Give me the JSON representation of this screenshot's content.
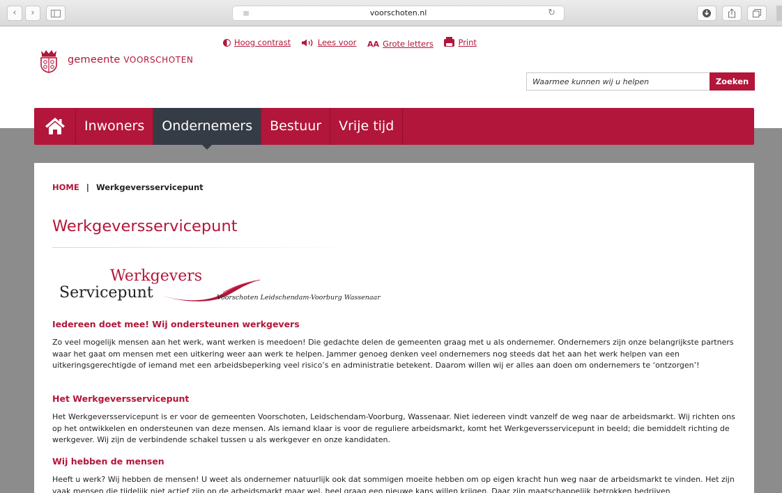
{
  "browser": {
    "url": "voorschoten.nl"
  },
  "header": {
    "logo_text_pre": "gemeente",
    "logo_text_name": "VOORSCHOTEN",
    "tools": [
      {
        "icon": "contrast-icon",
        "label": "Hoog contrast"
      },
      {
        "icon": "speaker-icon",
        "label": "Lees voor"
      },
      {
        "icon": "font-size-icon",
        "label": "Grote letters",
        "glyph": "AA"
      },
      {
        "icon": "print-icon",
        "label": "Print"
      }
    ],
    "search": {
      "placeholder": "Waarmee kunnen wij u helpen",
      "button_label": "Zoeken"
    }
  },
  "nav": {
    "items": [
      {
        "label": "Inwoners",
        "active": false
      },
      {
        "label": "Ondernemers",
        "active": true
      },
      {
        "label": "Bestuur",
        "active": false
      },
      {
        "label": "Vrije tijd",
        "active": false
      }
    ]
  },
  "content": {
    "breadcrumb": {
      "home": "HOME",
      "separator": "|",
      "current": "Werkgeversservicepunt"
    },
    "title": "Werkgeversservicepunt",
    "partner_logo": {
      "line1": "Werkgevers",
      "line2": "Servicepunt",
      "subtitle": "Voorschoten Leidschendam-Voorburg Wassenaar"
    },
    "sections": [
      {
        "heading": "Iedereen doet mee! Wij ondersteunen werkgevers",
        "body": "Zo veel mogelijk mensen aan het werk, want werken is meedoen! Die gedachte delen de gemeenten graag met u als ondernemer. Ondernemers zijn onze belangrijkste partners waar het gaat om mensen met een uitkering weer aan werk te helpen. Jammer genoeg denken veel ondernemers nog steeds dat het aan het werk helpen van een uitkeringsgerechtigde of iemand met een arbeidsbeperking veel risico’s en administratie betekent. Daarom willen wij er alles aan doen om  ondernemers te ‘ontzorgen’!"
      },
      {
        "heading": "Het Werkgeversservicepunt",
        "body": "Het Werkgeversservicepunt is er voor de gemeenten Voorschoten, Leidschendam-Voorburg, Wassenaar. Niet iedereen vindt vanzelf de weg naar de arbeidsmarkt. Wij richten ons op  het ontwikkelen en ondersteunen van deze mensen. Als iemand klaar is voor de reguliere arbeidsmarkt, komt het Werkgeversservicepunt in beeld; die bemiddelt richting de werkgever. Wij zijn de verbindende schakel tussen u als werkgever en onze kandidaten."
      },
      {
        "heading": "Wij hebben de mensen",
        "body": "Heeft u werk? Wij hebben de mensen! U weet als ondernemer natuurlijk ook dat sommigen moeite hebben om op eigen kracht hun weg naar de arbeidsmarkt te vinden. Het zijn vaak mensen die tijdelijk niet actief zijn op de arbeidsmarkt maar wel, heel graag een nieuwe kans willen krijgen. Daar zijn maatschappelijk betrokken bedrijven"
      }
    ]
  },
  "colors": {
    "brand": "#b2163a",
    "nav_active": "#363c45"
  }
}
